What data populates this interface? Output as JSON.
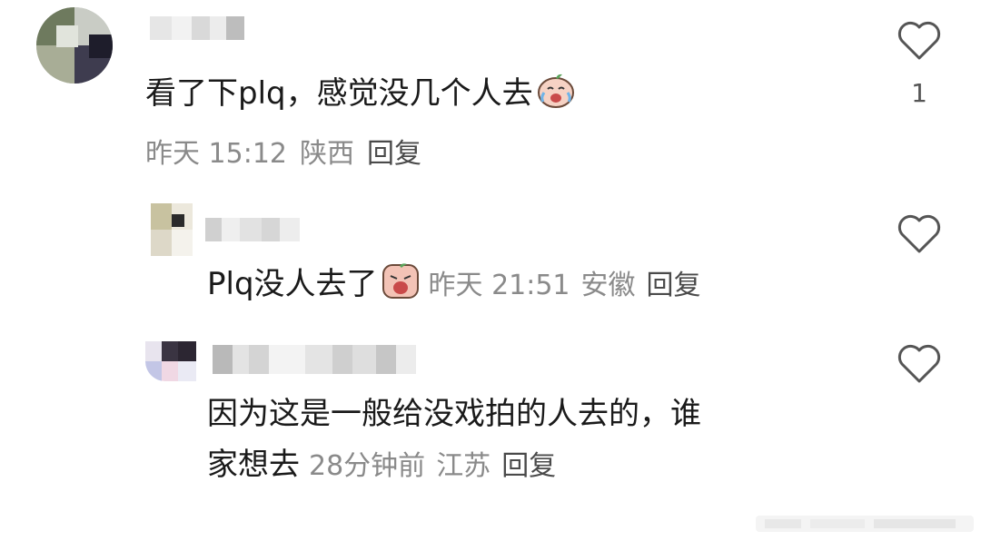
{
  "comments": [
    {
      "text": "看了下plq，感觉没几个人去",
      "time": "昨天 15:12",
      "location": "陕西",
      "reply_label": "回复",
      "likes": "1",
      "emoji": "crying-laugh-emoji"
    },
    {
      "text": "Plq没人去了",
      "time": "昨天 21:51",
      "location": "安徽",
      "reply_label": "回复",
      "emoji": "crying-emoji"
    },
    {
      "text_line1": "因为这是一般给没戏拍的人去的，谁",
      "text_line2": "家想去",
      "time": "28分钟前",
      "location": "江苏",
      "reply_label": "回复"
    }
  ],
  "colors": {
    "text": "#1a1a1a",
    "meta": "#8a8a8a",
    "heart_stroke": "#555555"
  }
}
